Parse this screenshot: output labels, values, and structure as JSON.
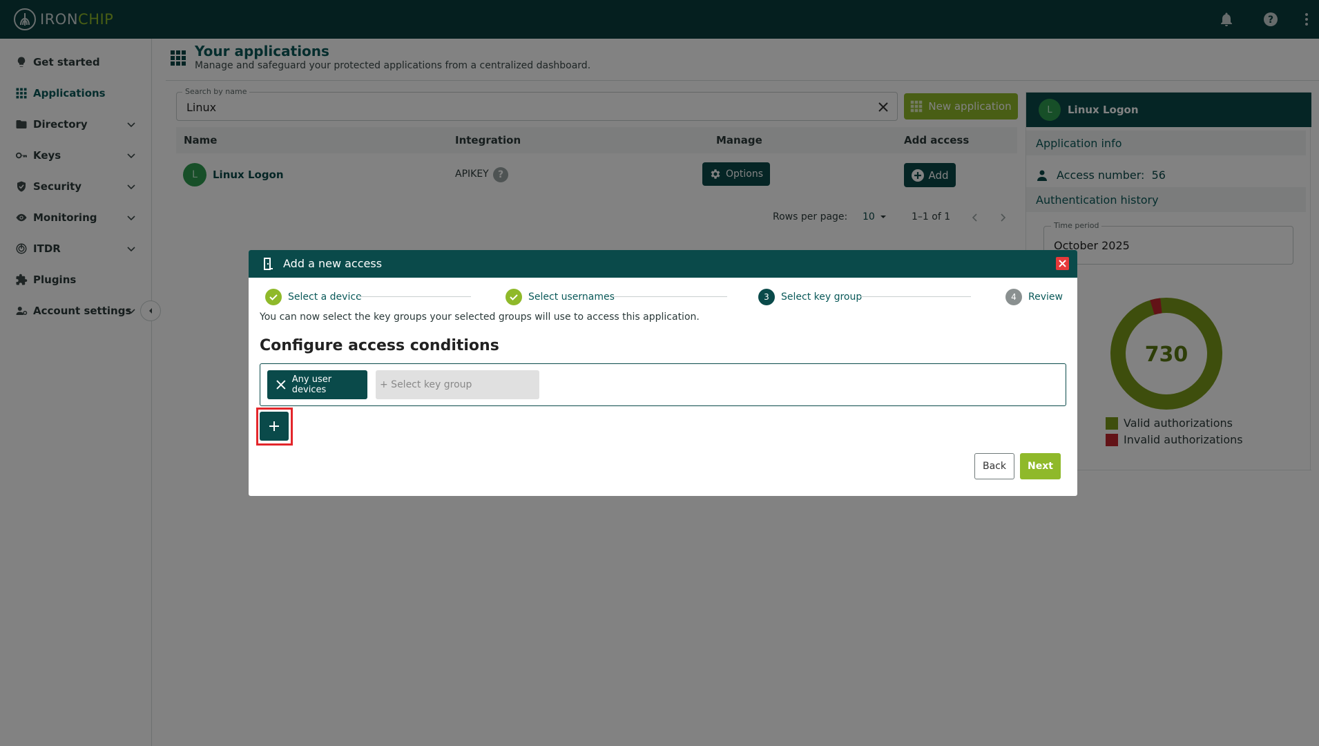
{
  "topbar": {
    "logo_iron": "IRON",
    "logo_chip": "CHIP",
    "icons": [
      "bell-icon",
      "help-icon",
      "more-vert-icon"
    ]
  },
  "sidebar": {
    "items": [
      {
        "label": "Get started",
        "icon": "lightbulb-icon",
        "expandable": false
      },
      {
        "label": "Applications",
        "icon": "apps-grid-icon",
        "expandable": false,
        "active": true
      },
      {
        "label": "Directory",
        "icon": "folder-icon",
        "expandable": true
      },
      {
        "label": "Keys",
        "icon": "key-icon",
        "expandable": true
      },
      {
        "label": "Security",
        "icon": "shield-icon",
        "expandable": true
      },
      {
        "label": "Monitoring",
        "icon": "eye-icon",
        "expandable": true
      },
      {
        "label": "ITDR",
        "icon": "itdr-icon",
        "expandable": true
      },
      {
        "label": "Plugins",
        "icon": "puzzle-icon",
        "expandable": false
      },
      {
        "label": "Account settings",
        "icon": "user-settings-icon",
        "expandable": true
      }
    ]
  },
  "page": {
    "title": "Your applications",
    "subtitle": "Manage and safeguard your protected applications from a centralized dashboard."
  },
  "search": {
    "label": "Search by name",
    "value": "Linux"
  },
  "new_application_label": "New application",
  "table": {
    "columns": [
      "Name",
      "Integration",
      "Manage",
      "Add access"
    ],
    "rows": [
      {
        "avatar": "L",
        "name": "Linux Logon",
        "integration": "APIKEY",
        "manage_label": "Options",
        "add_label": "Add"
      }
    ]
  },
  "pagination": {
    "rows_per_page_label": "Rows per page:",
    "rows_per_page": "10",
    "range": "1–1 of 1"
  },
  "right_panel": {
    "avatar": "L",
    "title": "Linux Logon",
    "app_info_label": "Application info",
    "access_number_label": "Access number:",
    "access_number": "56",
    "auth_history_label": "Authentication history",
    "time_period_label": "Time period",
    "time_period": "October 2025",
    "donut_total": "730",
    "donut_invalid_fraction": 0.03,
    "legend": [
      {
        "label": "Valid authorizations",
        "color": "#7a9a1a"
      },
      {
        "label": "Invalid authorizations",
        "color": "#c0272d"
      }
    ]
  },
  "modal": {
    "title": "Add a new access",
    "steps": [
      {
        "num": "1",
        "label": "Select a device",
        "state": "done"
      },
      {
        "num": "2",
        "label": "Select usernames",
        "state": "done"
      },
      {
        "num": "3",
        "label": "Select key group",
        "state": "active"
      },
      {
        "num": "4",
        "label": "Review",
        "state": "pending"
      }
    ],
    "description": "You can now select the key groups your selected groups will use to access this application.",
    "heading": "Configure access conditions",
    "chip_label": "Any user devices",
    "select_placeholder": "+ Select key group",
    "back_label": "Back",
    "next_label": "Next"
  },
  "colors": {
    "primary": "#0a4a4a",
    "accent": "#8fb92a",
    "danger": "#e8393a"
  }
}
